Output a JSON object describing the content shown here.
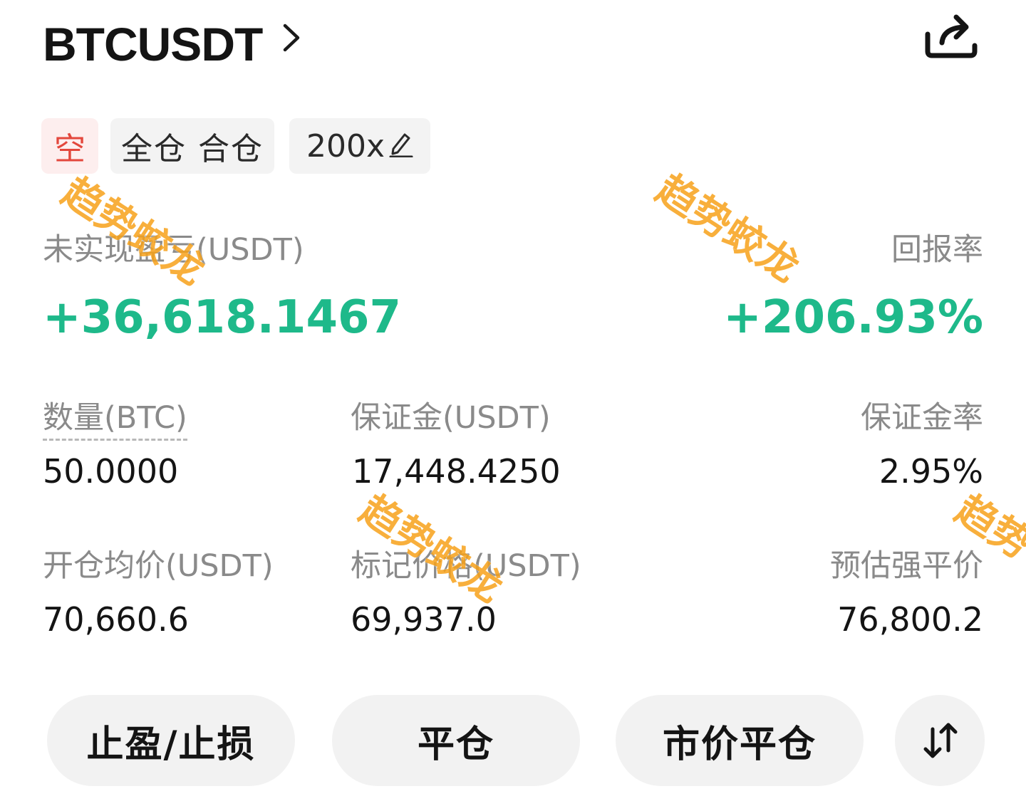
{
  "header": {
    "symbol": "BTCUSDT"
  },
  "tags": {
    "side": "空",
    "margin_mode": "全仓 合仓",
    "leverage": "200x"
  },
  "pnl": {
    "label": "未实现盈亏(USDT)",
    "value": "+36,618.1467",
    "roe_label": "回报率",
    "roe_value": "+206.93%",
    "accent_color": "#1eb98a"
  },
  "stats": {
    "quantity_label": "数量(BTC)",
    "quantity_value": "50.0000",
    "margin_label": "保证金(USDT)",
    "margin_value": "17,448.4250",
    "margin_ratio_label": "保证金率",
    "margin_ratio_value": "2.95%",
    "entry_label": "开仓均价(USDT)",
    "entry_value": "70,660.6",
    "mark_label": "标记价格(USDT)",
    "mark_value": "69,937.0",
    "liq_label": "预估强平价",
    "liq_value": "76,800.2"
  },
  "actions": {
    "tpsl": "止盈/止损",
    "close": "平仓",
    "market_close": "市价平仓",
    "reverse_icon": "swap-arrows-icon"
  },
  "icons": {
    "share": "share-icon",
    "chevron": "chevron-right-icon",
    "edit": "pencil-icon"
  },
  "watermark_text": "趋势蛟龙"
}
